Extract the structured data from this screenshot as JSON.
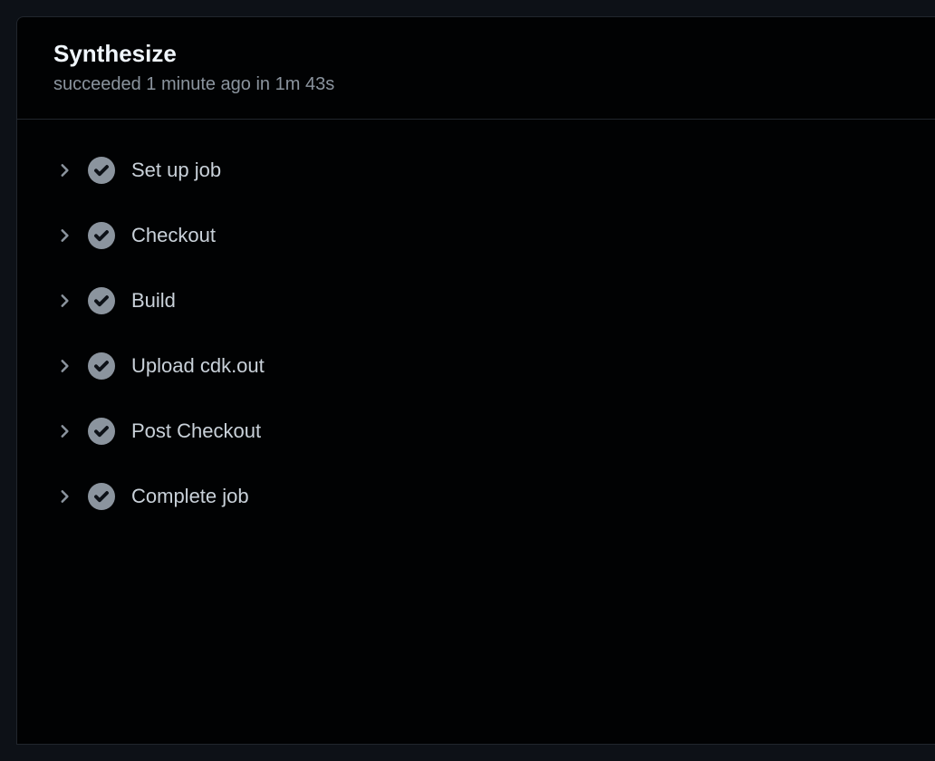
{
  "header": {
    "title": "Synthesize",
    "subtitle": "succeeded 1 minute ago in 1m 43s"
  },
  "steps": [
    {
      "label": "Set up job"
    },
    {
      "label": "Checkout"
    },
    {
      "label": "Build"
    },
    {
      "label": "Upload cdk.out"
    },
    {
      "label": "Post Checkout"
    },
    {
      "label": "Complete job"
    }
  ]
}
